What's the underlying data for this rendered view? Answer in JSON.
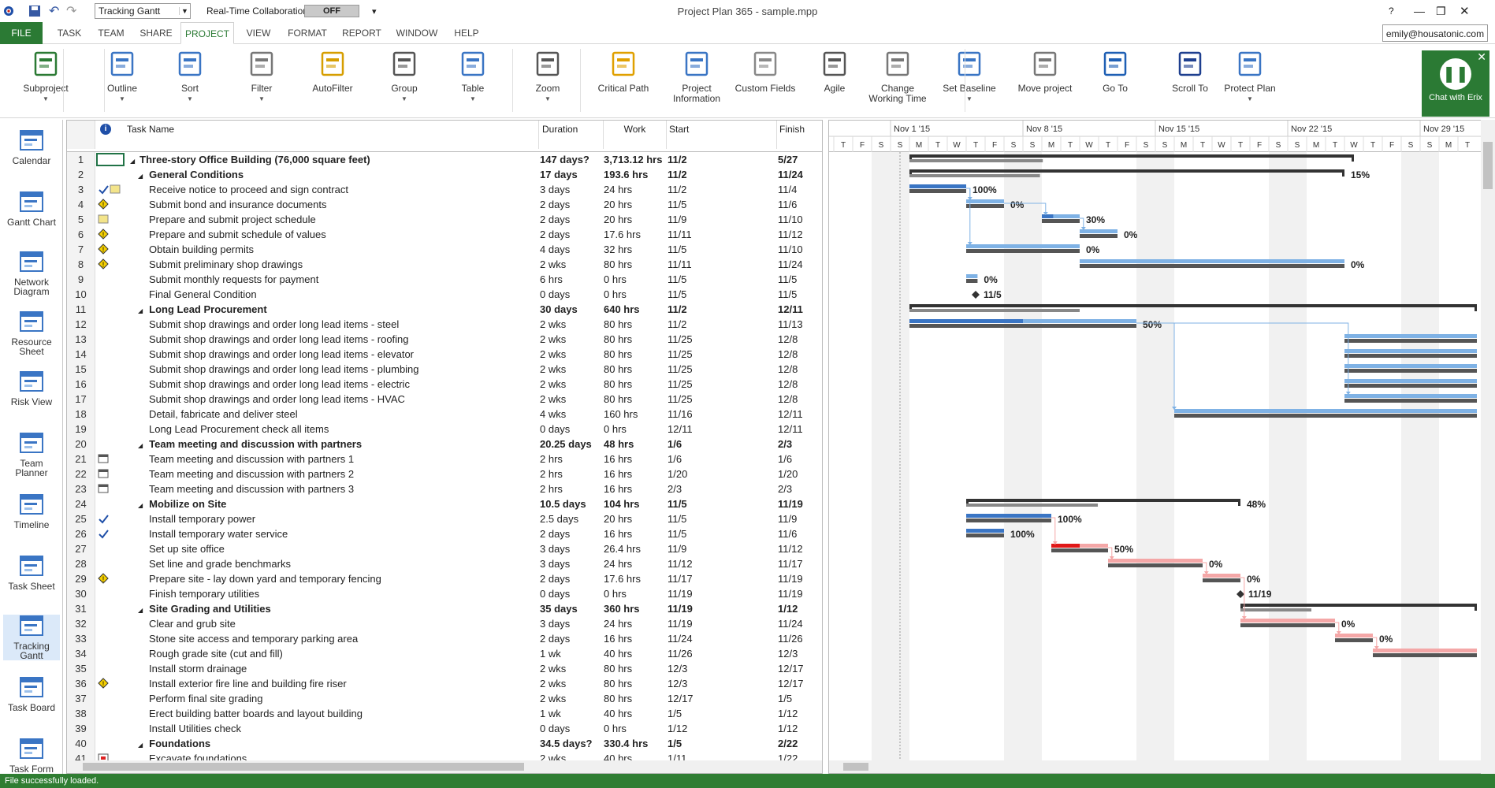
{
  "window": {
    "view_selector": "Tracking Gantt",
    "collab_label": "Real-Time Collaboration",
    "collab_state": "OFF",
    "title": "Project Plan 365 - sample.mpp",
    "help": "?",
    "user": "emily@housatonic.com"
  },
  "menu": {
    "file": "FILE",
    "tabs": [
      "TASK",
      "TEAM",
      "SHARE",
      "PROJECT",
      "VIEW",
      "FORMAT",
      "REPORT",
      "WINDOW",
      "HELP"
    ],
    "active": "PROJECT"
  },
  "ribbon": [
    {
      "label": "Subproject",
      "icon": "subproject-icon",
      "dd": true
    },
    {
      "label": "Outline",
      "icon": "outline-icon",
      "dd": true
    },
    {
      "label": "Sort",
      "icon": "sort-icon",
      "dd": true
    },
    {
      "label": "Filter",
      "icon": "filter-icon",
      "dd": true
    },
    {
      "label": "AutoFilter",
      "icon": "autofilter-icon",
      "dd": false
    },
    {
      "label": "Group",
      "icon": "group-icon",
      "dd": true
    },
    {
      "label": "Table",
      "icon": "table-icon",
      "dd": true
    },
    {
      "label": "Zoom",
      "icon": "zoom-icon",
      "dd": true
    },
    {
      "label": "Critical Path",
      "icon": "critical-path-icon",
      "dd": false
    },
    {
      "label": "Project Information",
      "icon": "project-information-icon",
      "dd": false
    },
    {
      "label": "Custom Fields",
      "icon": "custom-fields-icon",
      "dd": false
    },
    {
      "label": "Agile",
      "icon": "agile-icon",
      "dd": false
    },
    {
      "label": "Change Working Time",
      "icon": "change-working-time-icon",
      "dd": false
    },
    {
      "label": "Set Baseline",
      "icon": "set-baseline-icon",
      "dd": true
    },
    {
      "label": "Move project",
      "icon": "move-project-icon",
      "dd": false
    },
    {
      "label": "Go To",
      "icon": "go-to-icon",
      "dd": false
    },
    {
      "label": "Scroll To",
      "icon": "scroll-to-icon",
      "dd": false
    },
    {
      "label": "Protect Plan",
      "icon": "protect-plan-icon",
      "dd": true
    }
  ],
  "chat": {
    "label": "Chat with Erix",
    "icon": "chat-icon"
  },
  "views": [
    "Calendar",
    "Gantt Chart",
    "Network Diagram",
    "Resource Sheet",
    "Risk View",
    "Team Planner",
    "Timeline",
    "Task Sheet",
    "Tracking Gantt",
    "Task Board",
    "Task Form"
  ],
  "columns": {
    "info": "i",
    "name": "Task Name",
    "duration": "Duration",
    "work": "Work",
    "start": "Start",
    "finish": "Finish"
  },
  "tasks": [
    {
      "id": "1",
      "lvl": 0,
      "sum": true,
      "ind": "",
      "name": "Three-story Office Building (76,000 square feet)",
      "dur": "147 days?",
      "work": "3,713.12 hrs",
      "start": "11/2",
      "fin": "5/27"
    },
    {
      "id": "2",
      "lvl": 1,
      "sum": true,
      "ind": "",
      "name": "General Conditions",
      "dur": "17 days",
      "work": "193.6 hrs",
      "start": "11/2",
      "fin": "11/24"
    },
    {
      "id": "3",
      "lvl": 2,
      "sum": false,
      "ind": "check-note",
      "name": "Receive notice to proceed and sign contract",
      "dur": "3 days",
      "work": "24 hrs",
      "start": "11/2",
      "fin": "11/4"
    },
    {
      "id": "4",
      "lvl": 2,
      "sum": false,
      "ind": "warn",
      "name": "Submit bond and insurance documents",
      "dur": "2 days",
      "work": "20 hrs",
      "start": "11/5",
      "fin": "11/6"
    },
    {
      "id": "5",
      "lvl": 2,
      "sum": false,
      "ind": "note",
      "name": "Prepare and submit project schedule",
      "dur": "2 days",
      "work": "20 hrs",
      "start": "11/9",
      "fin": "11/10"
    },
    {
      "id": "6",
      "lvl": 2,
      "sum": false,
      "ind": "warn",
      "name": "Prepare and submit schedule of values",
      "dur": "2 days",
      "work": "17.6 hrs",
      "start": "11/11",
      "fin": "11/12"
    },
    {
      "id": "7",
      "lvl": 2,
      "sum": false,
      "ind": "warn",
      "name": "Obtain building permits",
      "dur": "4 days",
      "work": "32 hrs",
      "start": "11/5",
      "fin": "11/10"
    },
    {
      "id": "8",
      "lvl": 2,
      "sum": false,
      "ind": "warn",
      "name": "Submit preliminary shop drawings",
      "dur": "2 wks",
      "work": "80 hrs",
      "start": "11/11",
      "fin": "11/24"
    },
    {
      "id": "9",
      "lvl": 2,
      "sum": false,
      "ind": "",
      "name": "Submit monthly requests for payment",
      "dur": "6 hrs",
      "work": "0 hrs",
      "start": "11/5",
      "fin": "11/5"
    },
    {
      "id": "10",
      "lvl": 2,
      "sum": false,
      "ind": "",
      "name": "Final General Condition",
      "dur": "0 days",
      "work": "0 hrs",
      "start": "11/5",
      "fin": "11/5"
    },
    {
      "id": "11",
      "lvl": 1,
      "sum": true,
      "ind": "",
      "name": "Long Lead Procurement",
      "dur": "30 days",
      "work": "640 hrs",
      "start": "11/2",
      "fin": "12/11"
    },
    {
      "id": "12",
      "lvl": 2,
      "sum": false,
      "ind": "",
      "name": "Submit shop drawings and order long lead items - steel",
      "dur": "2 wks",
      "work": "80 hrs",
      "start": "11/2",
      "fin": "11/13"
    },
    {
      "id": "13",
      "lvl": 2,
      "sum": false,
      "ind": "",
      "name": "Submit shop drawings and order long lead items - roofing",
      "dur": "2 wks",
      "work": "80 hrs",
      "start": "11/25",
      "fin": "12/8"
    },
    {
      "id": "14",
      "lvl": 2,
      "sum": false,
      "ind": "",
      "name": "Submit shop drawings and order long lead items - elevator",
      "dur": "2 wks",
      "work": "80 hrs",
      "start": "11/25",
      "fin": "12/8"
    },
    {
      "id": "15",
      "lvl": 2,
      "sum": false,
      "ind": "",
      "name": "Submit shop drawings and order long lead items - plumbing",
      "dur": "2 wks",
      "work": "80 hrs",
      "start": "11/25",
      "fin": "12/8"
    },
    {
      "id": "16",
      "lvl": 2,
      "sum": false,
      "ind": "",
      "name": "Submit shop drawings and order long lead items - electric",
      "dur": "2 wks",
      "work": "80 hrs",
      "start": "11/25",
      "fin": "12/8"
    },
    {
      "id": "17",
      "lvl": 2,
      "sum": false,
      "ind": "",
      "name": "Submit shop drawings and order long lead items - HVAC",
      "dur": "2 wks",
      "work": "80 hrs",
      "start": "11/25",
      "fin": "12/8"
    },
    {
      "id": "18",
      "lvl": 2,
      "sum": false,
      "ind": "",
      "name": "Detail, fabricate and deliver steel",
      "dur": "4 wks",
      "work": "160 hrs",
      "start": "11/16",
      "fin": "12/11"
    },
    {
      "id": "19",
      "lvl": 2,
      "sum": false,
      "ind": "",
      "name": "Long Lead Procurement check all items",
      "dur": "0 days",
      "work": "0 hrs",
      "start": "12/11",
      "fin": "12/11"
    },
    {
      "id": "20",
      "lvl": 1,
      "sum": true,
      "ind": "",
      "name": "Team meeting and discussion with partners",
      "dur": "20.25 days",
      "work": "48 hrs",
      "start": "1/6",
      "fin": "2/3"
    },
    {
      "id": "21",
      "lvl": 2,
      "sum": false,
      "ind": "cal",
      "name": "Team meeting and discussion with partners 1",
      "dur": "2 hrs",
      "work": "16 hrs",
      "start": "1/6",
      "fin": "1/6"
    },
    {
      "id": "22",
      "lvl": 2,
      "sum": false,
      "ind": "cal",
      "name": "Team meeting and discussion with partners 2",
      "dur": "2 hrs",
      "work": "16 hrs",
      "start": "1/20",
      "fin": "1/20"
    },
    {
      "id": "23",
      "lvl": 2,
      "sum": false,
      "ind": "cal",
      "name": "Team meeting and discussion with partners 3",
      "dur": "2 hrs",
      "work": "16 hrs",
      "start": "2/3",
      "fin": "2/3"
    },
    {
      "id": "24",
      "lvl": 1,
      "sum": true,
      "ind": "",
      "name": "Mobilize on Site",
      "dur": "10.5 days",
      "work": "104 hrs",
      "start": "11/5",
      "fin": "11/19"
    },
    {
      "id": "25",
      "lvl": 2,
      "sum": false,
      "ind": "check",
      "name": "Install temporary power",
      "dur": "2.5 days",
      "work": "20 hrs",
      "start": "11/5",
      "fin": "11/9"
    },
    {
      "id": "26",
      "lvl": 2,
      "sum": false,
      "ind": "check",
      "name": "Install temporary water service",
      "dur": "2 days",
      "work": "16 hrs",
      "start": "11/5",
      "fin": "11/6"
    },
    {
      "id": "27",
      "lvl": 2,
      "sum": false,
      "ind": "",
      "name": "Set up site office",
      "dur": "3 days",
      "work": "26.4 hrs",
      "start": "11/9",
      "fin": "11/12"
    },
    {
      "id": "28",
      "lvl": 2,
      "sum": false,
      "ind": "",
      "name": "Set line and grade benchmarks",
      "dur": "3 days",
      "work": "24 hrs",
      "start": "11/12",
      "fin": "11/17"
    },
    {
      "id": "29",
      "lvl": 2,
      "sum": false,
      "ind": "warn",
      "name": "Prepare site - lay down yard and temporary fencing",
      "dur": "2 days",
      "work": "17.6 hrs",
      "start": "11/17",
      "fin": "11/19"
    },
    {
      "id": "30",
      "lvl": 2,
      "sum": false,
      "ind": "",
      "name": "Finish temporary utilities",
      "dur": "0 days",
      "work": "0 hrs",
      "start": "11/19",
      "fin": "11/19"
    },
    {
      "id": "31",
      "lvl": 1,
      "sum": true,
      "ind": "",
      "name": "Site Grading and Utilities",
      "dur": "35 days",
      "work": "360 hrs",
      "start": "11/19",
      "fin": "1/12"
    },
    {
      "id": "32",
      "lvl": 2,
      "sum": false,
      "ind": "",
      "name": "Clear and grub site",
      "dur": "3 days",
      "work": "24 hrs",
      "start": "11/19",
      "fin": "11/24"
    },
    {
      "id": "33",
      "lvl": 2,
      "sum": false,
      "ind": "",
      "name": "Stone site access and temporary parking area",
      "dur": "2 days",
      "work": "16 hrs",
      "start": "11/24",
      "fin": "11/26"
    },
    {
      "id": "34",
      "lvl": 2,
      "sum": false,
      "ind": "",
      "name": "Rough grade site (cut and fill)",
      "dur": "1 wk",
      "work": "40 hrs",
      "start": "11/26",
      "fin": "12/3"
    },
    {
      "id": "35",
      "lvl": 2,
      "sum": false,
      "ind": "",
      "name": "Install storm drainage",
      "dur": "2 wks",
      "work": "80 hrs",
      "start": "12/3",
      "fin": "12/17"
    },
    {
      "id": "36",
      "lvl": 2,
      "sum": false,
      "ind": "warn",
      "name": "Install exterior fire line and building fire riser",
      "dur": "2 wks",
      "work": "80 hrs",
      "start": "12/3",
      "fin": "12/17"
    },
    {
      "id": "37",
      "lvl": 2,
      "sum": false,
      "ind": "",
      "name": "Perform final site grading",
      "dur": "2 wks",
      "work": "80 hrs",
      "start": "12/17",
      "fin": "1/5"
    },
    {
      "id": "38",
      "lvl": 2,
      "sum": false,
      "ind": "",
      "name": "Erect building batter boards and layout building",
      "dur": "1 wk",
      "work": "40 hrs",
      "start": "1/5",
      "fin": "1/12"
    },
    {
      "id": "39",
      "lvl": 2,
      "sum": false,
      "ind": "",
      "name": "Install Utilities check",
      "dur": "0 days",
      "work": "0 hrs",
      "start": "1/12",
      "fin": "1/12"
    },
    {
      "id": "40",
      "lvl": 1,
      "sum": true,
      "ind": "",
      "name": "Foundations",
      "dur": "34.5 days?",
      "work": "330.4 hrs",
      "start": "1/5",
      "fin": "2/22"
    },
    {
      "id": "41",
      "lvl": 2,
      "sum": false,
      "ind": "red",
      "name": "Excavate foundations",
      "dur": "2 wks",
      "work": "40 hrs",
      "start": "1/11",
      "fin": "1/22"
    }
  ],
  "timescale": {
    "weeks": [
      "Nov 1 '15",
      "Nov 8 '15",
      "Nov 15 '15",
      "Nov 22 '15",
      "Nov 29 '15"
    ],
    "days": [
      "T",
      "F",
      "S",
      "S",
      "M",
      "T",
      "W",
      "T",
      "F",
      "S",
      "S",
      "M",
      "T",
      "W",
      "T",
      "F",
      "S",
      "S",
      "M",
      "T",
      "W",
      "T",
      "F",
      "S",
      "S",
      "M",
      "T",
      "W",
      "T",
      "F",
      "S",
      "S",
      "M",
      "T"
    ]
  },
  "gantt": {
    "bars": [
      {
        "row": 0,
        "kind": "summary",
        "s": 4,
        "e": 27.5,
        "pct": "",
        "done": 0
      },
      {
        "row": 1,
        "kind": "summary",
        "s": 4,
        "e": 27,
        "pct": "15%",
        "done": 0.15
      },
      {
        "row": 2,
        "kind": "task",
        "s": 4,
        "e": 7,
        "pct": "100%",
        "done": 1
      },
      {
        "row": 3,
        "kind": "task",
        "s": 7,
        "e": 9,
        "pct": "0%",
        "done": 0
      },
      {
        "row": 4,
        "kind": "task",
        "s": 11,
        "e": 13,
        "pct": "30%",
        "done": 0.3
      },
      {
        "row": 5,
        "kind": "task",
        "s": 13,
        "e": 15,
        "pct": "0%",
        "done": 0
      },
      {
        "row": 6,
        "kind": "task",
        "s": 7,
        "e": 13,
        "pct": "0%",
        "done": 0
      },
      {
        "row": 7,
        "kind": "task",
        "s": 13,
        "e": 27,
        "pct": "0%",
        "done": 0
      },
      {
        "row": 8,
        "kind": "task",
        "s": 7,
        "e": 7.6,
        "pct": "0%",
        "done": 0
      },
      {
        "row": 9,
        "kind": "milestone",
        "s": 7.5,
        "e": 7.5,
        "pct": "11/5",
        "done": 0
      },
      {
        "row": 10,
        "kind": "summary",
        "s": 4,
        "e": 34,
        "pct": "",
        "done": 0.1
      },
      {
        "row": 11,
        "kind": "task",
        "s": 4,
        "e": 16,
        "pct": "50%",
        "done": 0.5
      },
      {
        "row": 12,
        "kind": "task",
        "s": 27,
        "e": 34,
        "pct": "",
        "done": 0
      },
      {
        "row": 13,
        "kind": "task",
        "s": 27,
        "e": 34,
        "pct": "",
        "done": 0
      },
      {
        "row": 14,
        "kind": "task",
        "s": 27,
        "e": 34,
        "pct": "",
        "done": 0
      },
      {
        "row": 15,
        "kind": "task",
        "s": 27,
        "e": 34,
        "pct": "",
        "done": 0
      },
      {
        "row": 16,
        "kind": "task",
        "s": 27,
        "e": 34,
        "pct": "",
        "done": 0
      },
      {
        "row": 17,
        "kind": "task",
        "s": 18,
        "e": 34,
        "pct": "",
        "done": 0
      },
      {
        "row": 23,
        "kind": "summary",
        "s": 7,
        "e": 21.5,
        "pct": "48%",
        "done": 0.48
      },
      {
        "row": 24,
        "kind": "task",
        "s": 7,
        "e": 11.5,
        "pct": "100%",
        "done": 1
      },
      {
        "row": 25,
        "kind": "task",
        "s": 7,
        "e": 9,
        "pct": "100%",
        "done": 1
      },
      {
        "row": 26,
        "kind": "crit",
        "s": 11.5,
        "e": 14.5,
        "pct": "50%",
        "done": 0.5
      },
      {
        "row": 27,
        "kind": "crit",
        "s": 14.5,
        "e": 19.5,
        "pct": "0%",
        "done": 0
      },
      {
        "row": 28,
        "kind": "crit",
        "s": 19.5,
        "e": 21.5,
        "pct": "0%",
        "done": 0
      },
      {
        "row": 29,
        "kind": "milestone",
        "s": 21.5,
        "e": 21.5,
        "pct": "11/19",
        "done": 0
      },
      {
        "row": 30,
        "kind": "summary",
        "s": 21.5,
        "e": 34,
        "pct": "",
        "done": 0
      },
      {
        "row": 31,
        "kind": "crit",
        "s": 21.5,
        "e": 26.5,
        "pct": "0%",
        "done": 0
      },
      {
        "row": 32,
        "kind": "crit",
        "s": 26.5,
        "e": 28.5,
        "pct": "0%",
        "done": 0
      },
      {
        "row": 33,
        "kind": "crit",
        "s": 28.5,
        "e": 34,
        "pct": "",
        "done": 0
      }
    ]
  },
  "status": "File successfully loaded.",
  "colors": {
    "file": "#2b7a34",
    "accent": "#2b7a34",
    "chat": "#2b7a34",
    "bar": "#7fb2e5",
    "barDone": "#3a75c4",
    "baseline": "#555555",
    "crit": "#f4a7a7",
    "critDone": "#e01818"
  }
}
